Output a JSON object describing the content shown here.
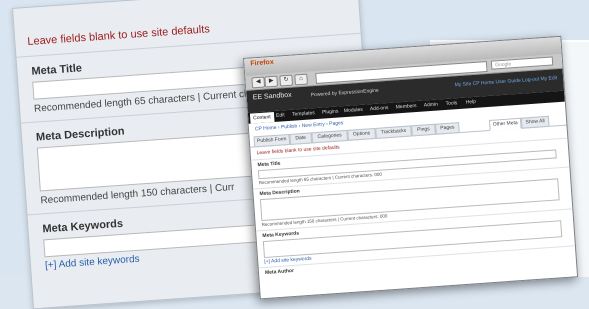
{
  "form": {
    "notice": "Leave fields blank to use site defaults",
    "meta_title_label": "Meta Title",
    "meta_title_value": "",
    "meta_title_hint": "Recommended length 65 characters | Current ch",
    "meta_description_label": "Meta Description",
    "meta_description_value": "",
    "meta_description_hint": "Recommended length 150 characters | Curr",
    "meta_keywords_label": "Meta Keywords",
    "meta_keywords_value": "",
    "add_keywords_link": "[+] Add site keywords"
  },
  "browser": {
    "window_title": "Firefox",
    "search_placeholder": "Google",
    "site_name": "EE Sandbox",
    "user_text": "Powered by ExpressionEngine",
    "admin_links": "My Site   CP Home   User Guide   Log-out   My Edit",
    "nav_items": [
      "Content",
      "Edit",
      "Templates",
      "Plugins",
      "Modules",
      "Add-ons",
      "Members",
      "Admin",
      "Tools",
      "Help"
    ],
    "breadcrumb": "CP Home › Publish › New Entry › Pages",
    "tabs": [
      "Publish Form",
      "Date",
      "Categories",
      "Options",
      "Trackbacks",
      "Pings",
      "Pages",
      "Other Meta",
      "Show All"
    ],
    "selected_tab": "Other Meta",
    "notice": "Leave fields blank to use site defaults",
    "meta_title_label": "Meta Title",
    "meta_title_hint": "Recommended length 65 characters | Current characters: 000",
    "meta_description_label": "Meta Description",
    "meta_description_hint": "Recommended length 150 characters | Current characters: 000",
    "meta_keywords_label": "Meta Keywords",
    "add_keywords_link": "[+] Add site keywords",
    "extra_label": "Meta Author"
  }
}
